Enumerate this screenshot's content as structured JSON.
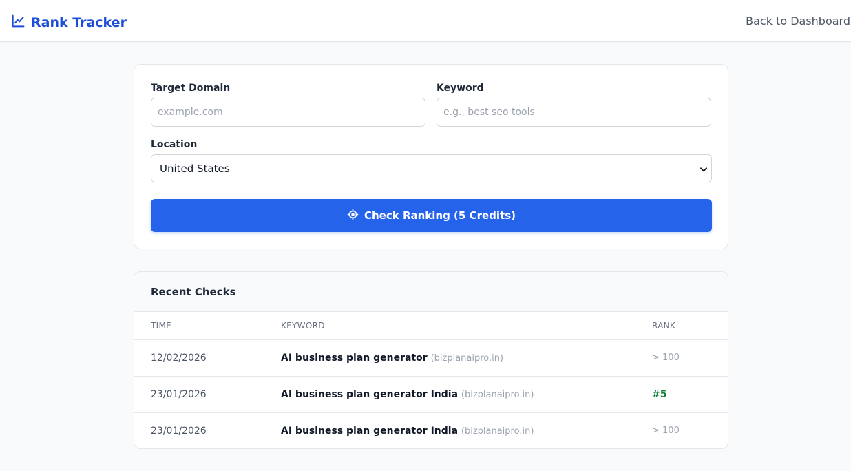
{
  "header": {
    "brand": "Rank Tracker",
    "brand_icon": "chart-line-icon",
    "back_link": "Back to Dashboard"
  },
  "form": {
    "domain_label": "Target Domain",
    "domain_placeholder": "example.com",
    "domain_value": "",
    "keyword_label": "Keyword",
    "keyword_placeholder": "e.g., best seo tools",
    "keyword_value": "",
    "location_label": "Location",
    "location_value": "United States",
    "submit_label": "Check Ranking (5 Credits)",
    "submit_icon": "crosshair-icon"
  },
  "recent": {
    "title": "Recent Checks",
    "columns": [
      "TIME",
      "KEYWORD",
      "RANK"
    ],
    "rows": [
      {
        "time": "12/02/2026",
        "keyword": "AI business plan generator",
        "domain": "(bizplanaipro.in)",
        "rank": "> 100",
        "rank_found": false
      },
      {
        "time": "23/01/2026",
        "keyword": "AI business plan generator India",
        "domain": "(bizplanaipro.in)",
        "rank": "#5",
        "rank_found": true
      },
      {
        "time": "23/01/2026",
        "keyword": "AI business plan generator India",
        "domain": "(bizplanaipro.in)",
        "rank": "> 100",
        "rank_found": false
      }
    ]
  },
  "colors": {
    "accent": "#2563eb",
    "brand": "#1d4ed8",
    "rank_good": "#15803d"
  }
}
